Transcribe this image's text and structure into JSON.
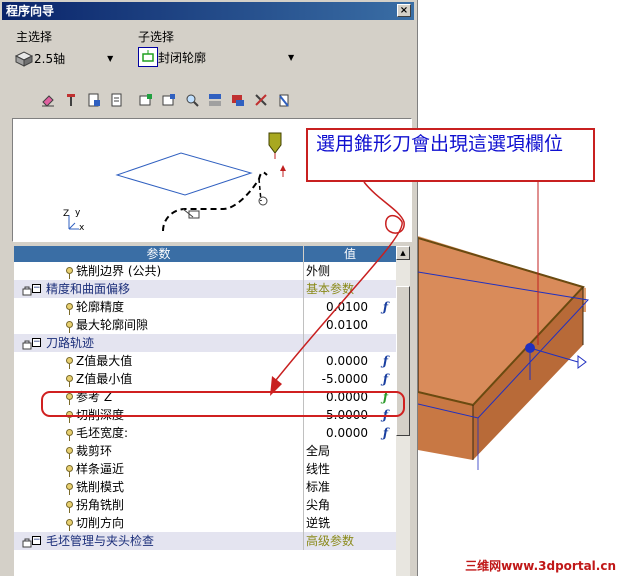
{
  "window": {
    "title": "程序向导",
    "close_glyph": "×"
  },
  "main_select": {
    "label": "主选择",
    "value": "2.5轴",
    "icon": "cube-icon"
  },
  "sub_select": {
    "label": "子选择",
    "value": "封闭轮廓",
    "icon": "closed-contour-icon"
  },
  "toolbar": {
    "icons": [
      "eraser-icon",
      "pin-icon",
      "document-add-icon",
      "document-edit-icon",
      "export-icon",
      "import-icon",
      "search-icon",
      "tree-icon",
      "settings-icon",
      "tools-icon",
      "delete-icon"
    ]
  },
  "grid": {
    "header_param": "参数",
    "header_value": "值",
    "rows": [
      {
        "type": "prop",
        "label": "铣削边界 (公共)",
        "value": "外侧"
      },
      {
        "type": "cat",
        "label": "精度和曲面偏移",
        "value": "基本参数"
      },
      {
        "type": "prop",
        "label": "轮廓精度",
        "value": "0.0100",
        "fx": true
      },
      {
        "type": "prop",
        "label": "最大轮廓间隙",
        "value": "0.0100"
      },
      {
        "type": "cat",
        "label": "刀路轨迹",
        "value": ""
      },
      {
        "type": "prop",
        "label": "Z值最大值",
        "value": "0.0000",
        "fx": true
      },
      {
        "type": "prop",
        "label": "Z值最小值",
        "value": "-5.0000",
        "fx": true
      },
      {
        "type": "prop",
        "label": "参考 Z",
        "value": "0.0000",
        "fx": true,
        "fx_color": "green"
      },
      {
        "type": "prop",
        "label": "切削深度",
        "value": "5.0000",
        "fx": true
      },
      {
        "type": "prop",
        "label": "毛坯宽度:",
        "value": "0.0000",
        "fx": true
      },
      {
        "type": "prop",
        "label": "裁剪环",
        "value": "全局"
      },
      {
        "type": "prop",
        "label": "样条逼近",
        "value": "线性"
      },
      {
        "type": "prop",
        "label": "铣削模式",
        "value": "标准"
      },
      {
        "type": "prop",
        "label": "拐角铣削",
        "value": "尖角"
      },
      {
        "type": "prop",
        "label": "切削方向",
        "value": "逆铣"
      },
      {
        "type": "cat",
        "label": "毛坯管理与夹头检查",
        "value": "高级参数"
      }
    ]
  },
  "preview": {
    "axis_z": "Z",
    "axis_y": "y",
    "axis_x": "x"
  },
  "annotation": {
    "text": "選用錐形刀會出現這選項欄位"
  },
  "watermark": "三维网www.3dportal.cn",
  "colors": {
    "title_bar": "#0a246a",
    "annotation_border": "#c82020",
    "annotation_text": "#1010d0",
    "block_face": "#d98b5a"
  }
}
